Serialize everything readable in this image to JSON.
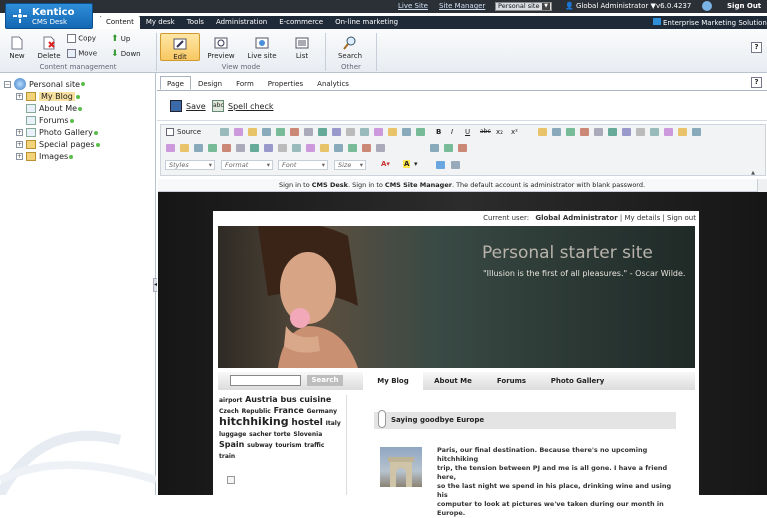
{
  "brand": {
    "name": "Kentico",
    "product": "CMS Desk"
  },
  "topbar": {
    "live_site": "Live Site",
    "site_manager": "Site Manager",
    "site_select": "Personal site",
    "user": "Global Administrator",
    "version": "v6.0.4237",
    "sign_out": "Sign Out",
    "ems": "Enterprise Marketing Solution"
  },
  "main_tabs": [
    "Content",
    "My desk",
    "Tools",
    "Administration",
    "E-commerce",
    "On-line marketing"
  ],
  "ribbon": {
    "new": "New",
    "delete": "Delete",
    "copy": "Copy",
    "move": "Move",
    "up": "Up",
    "down": "Down",
    "group_content": "Content management",
    "edit": "Edit",
    "preview": "Preview",
    "live_site": "Live site",
    "list": "List",
    "group_view": "View mode",
    "search": "Search",
    "group_other": "Other"
  },
  "tree": {
    "root": "Personal site",
    "items": [
      "My Blog",
      "About Me",
      "Forums",
      "Photo Gallery",
      "Special pages",
      "Images"
    ]
  },
  "content_tabs": [
    "Page",
    "Design",
    "Form",
    "Properties",
    "Analytics"
  ],
  "actions": {
    "save": "Save",
    "spell": "Spell check"
  },
  "editor": {
    "source": "Source",
    "styles": "Styles",
    "format": "Format",
    "font": "Font",
    "size": "Size"
  },
  "notice": {
    "p1": "Sign in to ",
    "cms_desk": "CMS Desk",
    "p2": ". Sign in to ",
    "site_manager": "CMS Site Manager",
    "p3": ". The default account is administrator with blank password."
  },
  "site": {
    "current_user_label": "Current user:",
    "current_user": "Global Administrator",
    "my_details": "My details",
    "sign_out": "Sign out",
    "title": "Personal starter site",
    "quote": "\"Illusion is the first of all pleasures.\" - Oscar Wilde.",
    "search_btn": "Search",
    "nav": [
      "My Blog",
      "About Me",
      "Forums",
      "Photo Gallery"
    ],
    "tags": [
      "airport",
      "Austria",
      "bus",
      "cuisine",
      "Czech",
      "Republic",
      "France",
      "Germany",
      "hitchhiking",
      "hostel",
      "Italy",
      "luggage",
      "sacher torte",
      "Slovenia",
      "Spain",
      "subway",
      "tourism",
      "traffic",
      "train"
    ],
    "post_title": "Saying goodbye Europe",
    "post_text": [
      "Paris, our final destination. Because there's no upcoming hitchhiking",
      "trip, the tension between PJ and me is all gone. I have a friend here,",
      "so the last night we spend in his place, drinking wine and using his",
      "computer to look at pictures we've taken during our month in Europe."
    ]
  }
}
